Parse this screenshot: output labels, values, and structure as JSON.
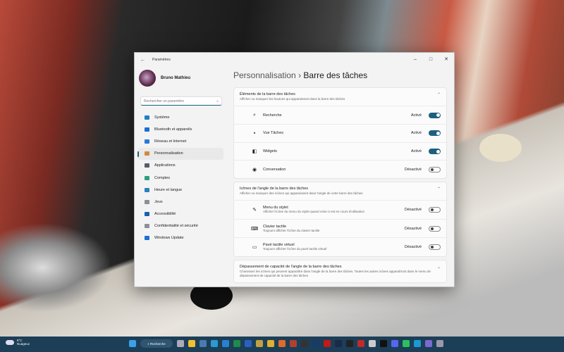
{
  "window": {
    "title": "Paramètres",
    "back": "←",
    "minimize": "–",
    "maximize": "□",
    "close": "✕"
  },
  "user": {
    "name": "Bruno Mathieu"
  },
  "search": {
    "placeholder": "Rechercher un paramètre",
    "icon": "⌕"
  },
  "nav": [
    {
      "label": "Système",
      "color": "#1d7fc4"
    },
    {
      "label": "Bluetooth et appareils",
      "color": "#1a6fd0"
    },
    {
      "label": "Réseau et Internet",
      "color": "#2a7ad0"
    },
    {
      "label": "Personnalisation",
      "color": "#d08a40",
      "selected": true
    },
    {
      "label": "Applications",
      "color": "#555d6a"
    },
    {
      "label": "Comptes",
      "color": "#2aa080"
    },
    {
      "label": "Heure et langue",
      "color": "#2a80c0"
    },
    {
      "label": "Jeux",
      "color": "#8a8f99"
    },
    {
      "label": "Accessibilité",
      "color": "#1a5fb0"
    },
    {
      "label": "Confidentialité et sécurité",
      "color": "#8a8f99"
    },
    {
      "label": "Windows Update",
      "color": "#1a70d0"
    }
  ],
  "breadcrumb": {
    "parent": "Personnalisation",
    "sep": "›",
    "current": "Barre des tâches"
  },
  "sections": [
    {
      "title": "Éléments de la barre des tâches",
      "desc": "Afficher ou masquer les boutons qui apparaissent dans la barre des tâches",
      "chevron": "⌃",
      "rows": [
        {
          "label": "Recherche",
          "icon": "⌕",
          "state": "Activé",
          "on": true
        },
        {
          "label": "Vue Tâches",
          "icon": "▪",
          "state": "Activé",
          "on": true
        },
        {
          "label": "Widgets",
          "icon": "◧",
          "state": "Activé",
          "on": true
        },
        {
          "label": "Conversation",
          "icon": "◉",
          "state": "Désactivé",
          "on": false
        }
      ]
    },
    {
      "title": "Icônes de l'angle de la barre des tâches",
      "desc": "Afficher ou masquer des icônes qui apparaissent dans l'angle de votre barre des tâches",
      "chevron": "⌃",
      "rows": [
        {
          "label": "Menu du stylet",
          "sub": "Afficher l'icône du menu du stylet quand celui-ci est en cours d'utilisation",
          "icon": "✎",
          "state": "Désactivé",
          "on": false
        },
        {
          "label": "Clavier tactile",
          "sub": "Toujours afficher l'icône du clavier tactile",
          "icon": "⌨",
          "state": "Désactivé",
          "on": false
        },
        {
          "label": "Pavé tactile virtuel",
          "sub": "Toujours afficher l'icône du pavé tactile virtuel",
          "icon": "▭",
          "state": "Désactivé",
          "on": false
        }
      ]
    },
    {
      "title": "Dépassement de capacité de l'angle de la barre des tâches",
      "desc": "Choisissez les icônes qui peuvent apparaître dans l'angle de la barre des tâches. Toutes les autres icônes apparaîtront dans le menu de dépassement de capacité de la barre des tâches",
      "chevron": "⌄"
    }
  ],
  "taskbar": {
    "weather": {
      "temp": "5°C",
      "condition": "Nuageux"
    },
    "search_label": "Recherche",
    "apps": [
      {
        "name": "start",
        "color": "#3aa0e8"
      },
      {
        "name": "task-view",
        "color": "#aab"
      },
      {
        "name": "file-explorer",
        "color": "#f0c030"
      },
      {
        "name": "app",
        "color": "#4a7ab0"
      },
      {
        "name": "edge",
        "color": "#2a9ad0"
      },
      {
        "name": "outlook",
        "color": "#2a80d0"
      },
      {
        "name": "excel",
        "color": "#1f8a4a"
      },
      {
        "name": "word",
        "color": "#2a60c0"
      },
      {
        "name": "app",
        "color": "#c0a040"
      },
      {
        "name": "chrome",
        "color": "#e0b030"
      },
      {
        "name": "firefox",
        "color": "#e06a2a"
      },
      {
        "name": "app",
        "color": "#b04030"
      },
      {
        "name": "app",
        "color": "#333"
      },
      {
        "name": "photoshop",
        "color": "#1a3a6a"
      },
      {
        "name": "netflix",
        "color": "#c01a1a"
      },
      {
        "name": "prime-video",
        "color": "#1a2a4a"
      },
      {
        "name": "app",
        "color": "#222"
      },
      {
        "name": "filezilla",
        "color": "#c02a2a"
      },
      {
        "name": "app",
        "color": "#ccc"
      },
      {
        "name": "tiktok",
        "color": "#111"
      },
      {
        "name": "discord",
        "color": "#5865f2"
      },
      {
        "name": "whatsapp",
        "color": "#2ac060"
      },
      {
        "name": "skype",
        "color": "#1a9ad0"
      },
      {
        "name": "teams",
        "color": "#7a6ad0"
      },
      {
        "name": "settings",
        "color": "#99a"
      }
    ]
  }
}
